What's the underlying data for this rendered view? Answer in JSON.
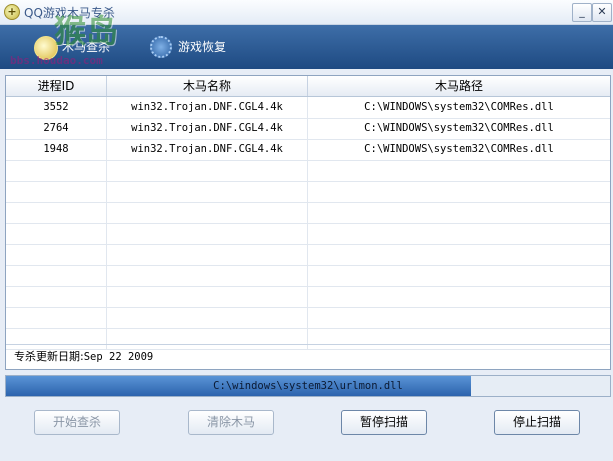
{
  "window": {
    "title": "QQ游戏木马专杀",
    "minimize_label": "_",
    "close_label": "✕"
  },
  "watermark": {
    "brand": "猴岛",
    "url": "bbs.houdao.com"
  },
  "toolbar": {
    "tabs": [
      {
        "label": "木马查杀",
        "icon": "magnifier-icon"
      },
      {
        "label": "游戏恢复",
        "icon": "restore-globe-icon"
      }
    ]
  },
  "table": {
    "columns": [
      "进程ID",
      "木马名称",
      "木马路径"
    ],
    "rows": [
      [
        "3552",
        "win32.Trojan.DNF.CGL4.4k",
        "C:\\WINDOWS\\system32\\COMRes.dll"
      ],
      [
        "2764",
        "win32.Trojan.DNF.CGL4.4k",
        "C:\\WINDOWS\\system32\\COMRes.dll"
      ],
      [
        "1948",
        "win32.Trojan.DNF.CGL4.4k",
        "C:\\WINDOWS\\system32\\COMRes.dll"
      ]
    ],
    "empty_rows": 9
  },
  "status": {
    "update_label": "专杀更新日期:",
    "update_date": "Sep 22 2009"
  },
  "progress": {
    "current_file": "C:\\windows\\system32\\urlmon.dll",
    "fraction": 0.77
  },
  "buttons": {
    "start_scan": "开始查杀",
    "remove_trojan": "清除木马",
    "pause_scan": "暂停扫描",
    "stop_scan": "停止扫描"
  },
  "colors": {
    "toolbar_top": "#3e6ea8",
    "toolbar_bottom": "#1e4a82",
    "progress_fill": "#2c63ad"
  }
}
